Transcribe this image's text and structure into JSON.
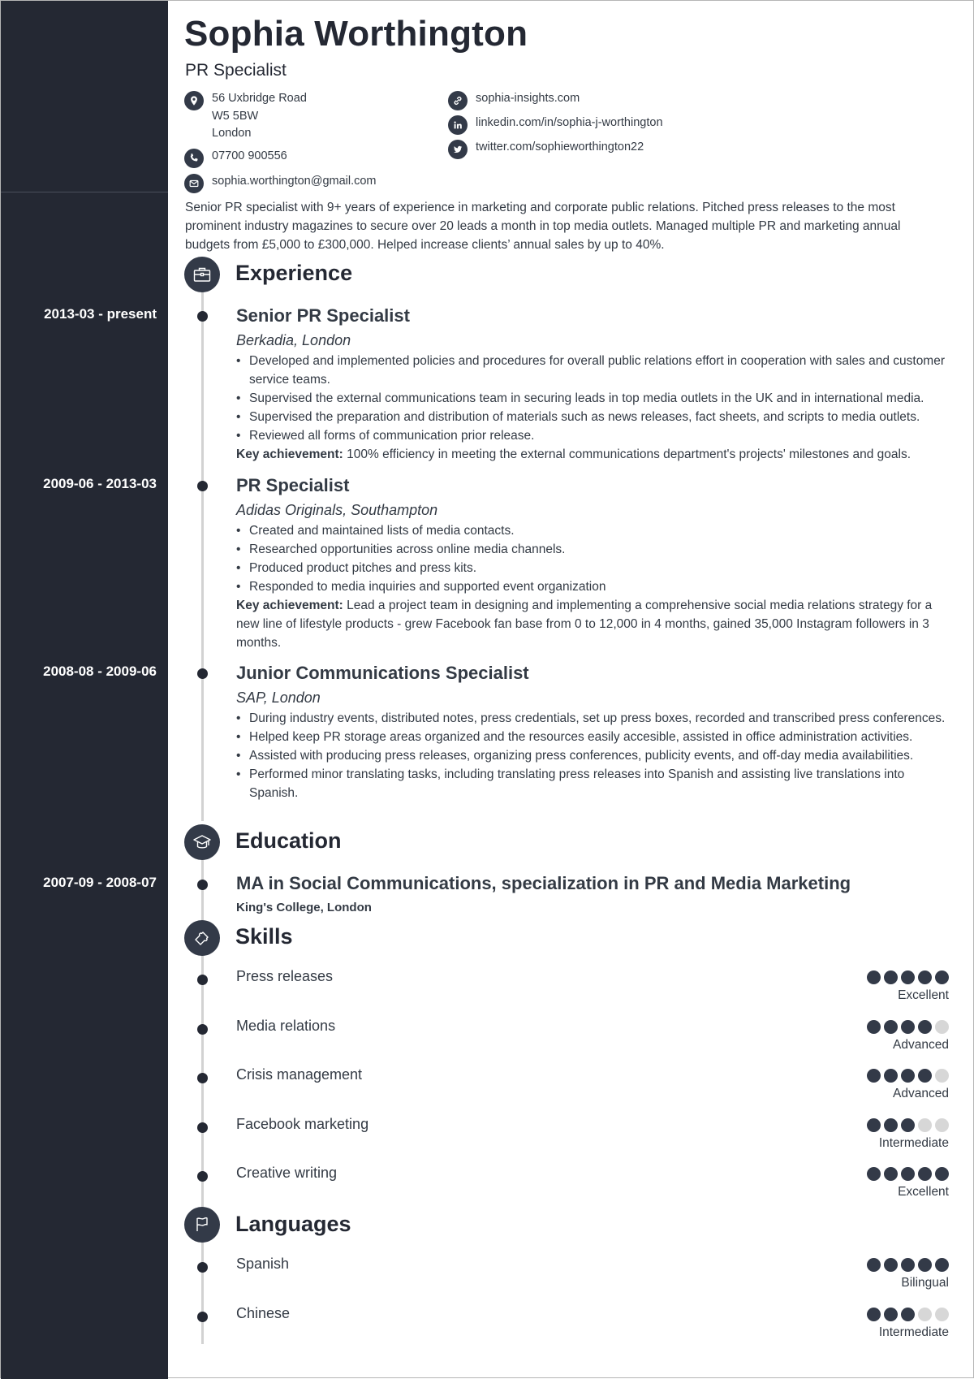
{
  "header": {
    "name": "Sophia Worthington",
    "title": "PR Specialist"
  },
  "contact": {
    "address": [
      "56 Uxbridge Road",
      "W5 5BW",
      "London"
    ],
    "phone": "07700 900556",
    "email": "sophia.worthington@gmail.com",
    "website": "sophia-insights.com",
    "linkedin": "linkedin.com/in/sophia-j-worthington",
    "twitter": "twitter.com/sophieworthington22"
  },
  "summary": "Senior PR specialist with 9+ years of experience in marketing and corporate public relations. Pitched press releases to the most prominent industry magazines to secure over 20 leads a month in top media outlets. Managed multiple PR and marketing annual budgets from £5,000 to £300,000. Helped increase clients’ annual sales by up to 40%.",
  "sections": {
    "experience": "Experience",
    "education": "Education",
    "skills": "Skills",
    "languages": "Languages"
  },
  "experience": [
    {
      "dates": "2013-03 - present",
      "title": "Senior PR Specialist",
      "company": "Berkadia, London",
      "bullets": [
        "Developed and implemented policies and procedures for overall public relations effort in cooperation with sales and customer service teams.",
        "Supervised the external communications team in securing leads in top media outlets in the UK and in international media.",
        "Supervised the preparation and distribution of materials such as news releases, fact sheets, and scripts to media outlets.",
        "Reviewed all forms of communication prior release."
      ],
      "achievement_label": "Key achievement:",
      "achievement": " 100% efficiency in meeting the external communications department's projects' milestones and goals."
    },
    {
      "dates": "2009-06 - 2013-03",
      "title": "PR Specialist",
      "company": "Adidas Originals, Southampton",
      "bullets": [
        "Created and maintained lists of media contacts.",
        "Researched opportunities across online media channels.",
        "Produced product pitches and press kits.",
        "Responded to media inquiries and supported event organization"
      ],
      "achievement_label": "Key achievement:",
      "achievement": " Lead a project team in designing and implementing a comprehensive social media relations strategy for a new line of lifestyle products - grew Facebook fan base from 0 to 12,000 in 4 months, gained 35,000 Instagram followers in 3 months."
    },
    {
      "dates": "2008-08 - 2009-06",
      "title": "Junior Communications Specialist",
      "company": "SAP, London",
      "bullets": [
        "During industry events, distributed notes, press credentials, set up press boxes, recorded and transcribed press conferences.",
        "Helped keep PR storage areas organized and the resources easily accesible, assisted in office administration activities.",
        "Assisted with producing press releases, organizing press conferences, publicity events, and off-day media availabilities.",
        "Performed minor translating tasks, including translating press releases into Spanish and assisting live translations into Spanish."
      ]
    }
  ],
  "education": [
    {
      "dates": "2007-09 - 2008-07",
      "degree": "MA in Social Communications, specialization in PR and Media Marketing",
      "school": "King's College, London"
    }
  ],
  "skills": [
    {
      "name": "Press releases",
      "level": 5,
      "max": 5,
      "label": "Excellent"
    },
    {
      "name": "Media relations",
      "level": 4,
      "max": 5,
      "label": "Advanced"
    },
    {
      "name": "Crisis management",
      "level": 4,
      "max": 5,
      "label": "Advanced"
    },
    {
      "name": "Facebook marketing",
      "level": 3,
      "max": 5,
      "label": "Intermediate"
    },
    {
      "name": "Creative writing",
      "level": 5,
      "max": 5,
      "label": "Excellent"
    }
  ],
  "languages": [
    {
      "name": "Spanish",
      "level": 5,
      "max": 5,
      "label": "Bilingual"
    },
    {
      "name": "Chinese",
      "level": 3,
      "max": 5,
      "label": "Intermediate"
    }
  ],
  "colors": {
    "sidebar": "#242833",
    "accent": "#333a48",
    "inactive_dot": "#d7d7d7",
    "timeline": "#d2d2d2"
  }
}
